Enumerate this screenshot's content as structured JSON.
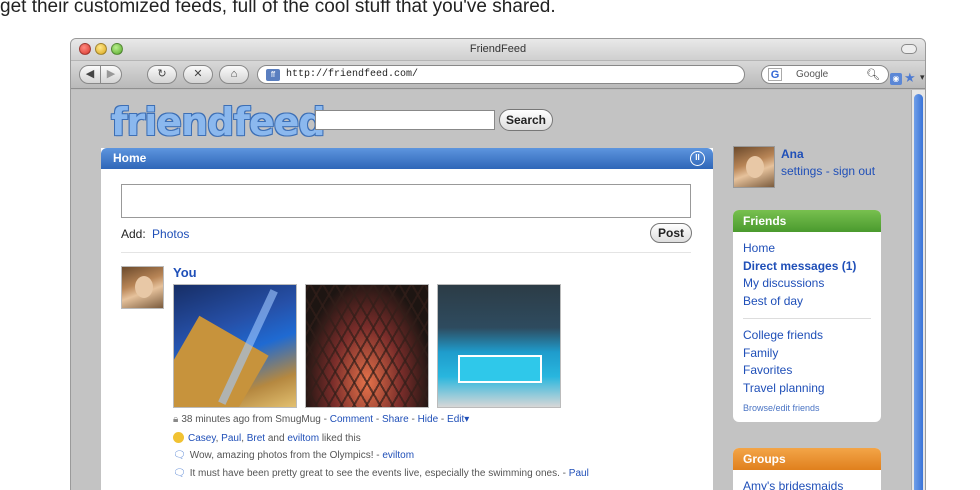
{
  "caption": "get their customized feeds, full of the cool stuff that you've shared.",
  "browser": {
    "title": "FriendFeed",
    "url": "http://friendfeed.com/",
    "search_placeholder": "Google",
    "icons": [
      "back-icon",
      "forward-icon",
      "reload-icon",
      "stop-icon",
      "home-icon",
      "rss-icon",
      "star-icon",
      "google-icon",
      "magnifier-icon"
    ]
  },
  "site": {
    "logo": "friendfeed",
    "search_button": "Search"
  },
  "main": {
    "title": "Home",
    "add_label": "Add:",
    "add_link": "Photos",
    "post_button": "Post",
    "entry": {
      "user": "You",
      "photos": [
        "olympic-stadium-light-show",
        "birds-nest-stadium-night",
        "water-cube-diving-pool"
      ],
      "time_text": "38 minutes ago from SmugMug -",
      "actions": [
        "Comment",
        "Share",
        "Hide",
        "Edit"
      ],
      "likes": {
        "names": [
          "Casey",
          "Paul",
          "Bret"
        ],
        "and": "and",
        "last": "eviltom",
        "suffix": "liked this"
      },
      "comments": [
        {
          "text": "Wow, amazing photos from the Olympics! -",
          "author": "eviltom"
        },
        {
          "text": "It must have been pretty great to see the events live, especially the swimming ones. -",
          "author": "Paul"
        }
      ]
    }
  },
  "sidebar": {
    "user_name": "Ana",
    "settings": "settings",
    "sign_out": "sign out",
    "friends": {
      "title": "Friends",
      "items": [
        "Home",
        "Direct messages (1)",
        "My discussions",
        "Best of day"
      ],
      "lists": [
        "College friends",
        "Family",
        "Favorites",
        "Travel planning"
      ],
      "browse": "Browse/edit friends"
    },
    "groups": {
      "title": "Groups",
      "items": [
        "Amy's bridesmaids"
      ]
    }
  },
  "colors": {
    "link": "#1f4fb8",
    "home_header": "#2f66b8",
    "friends_header": "#4a9a2e",
    "groups_header": "#e0801d"
  }
}
